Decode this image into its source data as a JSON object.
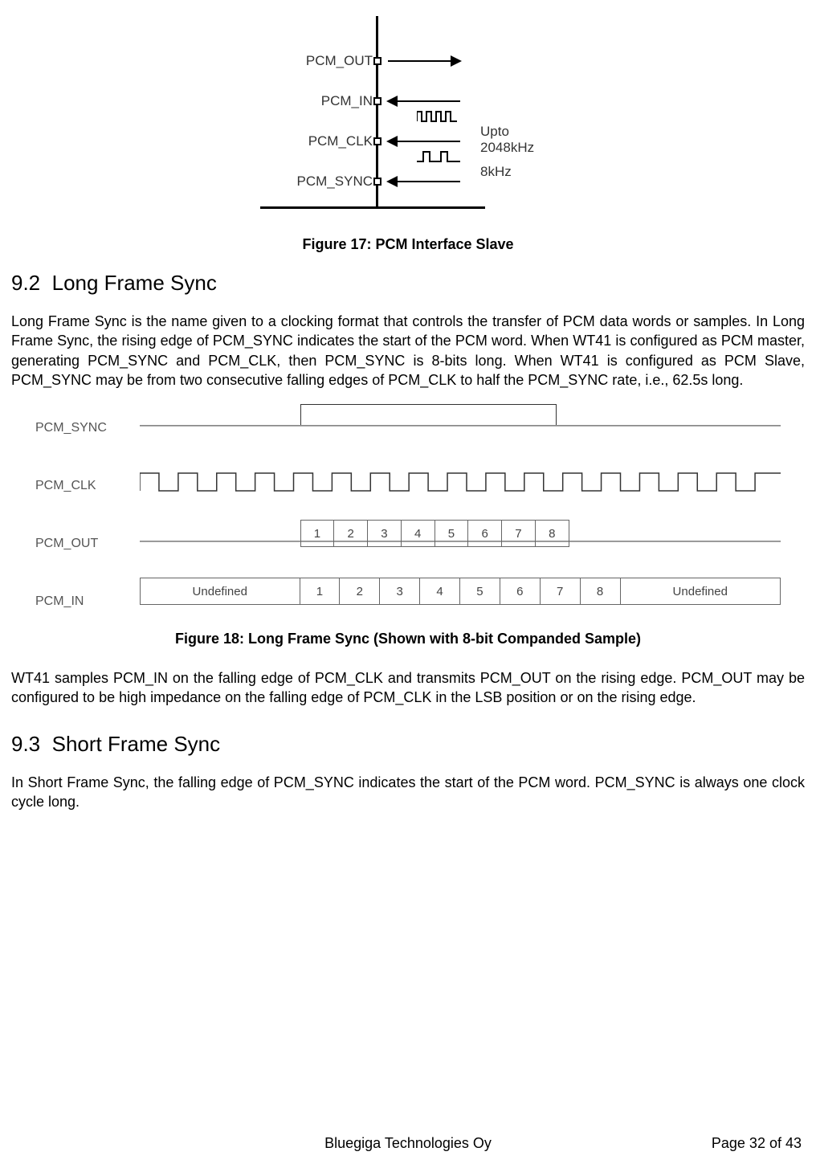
{
  "figure17": {
    "caption": "Figure 17: PCM Interface Slave",
    "signals": {
      "pcm_out": "PCM_OUT",
      "pcm_in": "PCM_IN",
      "pcm_clk": "PCM_CLK",
      "pcm_sync": "PCM_SYNC"
    },
    "notes": {
      "clk": "Upto 2048kHz",
      "sync": "8kHz"
    }
  },
  "section92": {
    "number": "9.2",
    "title": "Long Frame Sync",
    "para": "Long Frame Sync is the name given to a clocking format that controls the transfer of PCM data words or samples. In Long Frame Sync, the rising edge of PCM_SYNC indicates the start of the PCM word. When WT41 is configured as PCM master, generating PCM_SYNC and PCM_CLK, then PCM_SYNC is 8-bits long. When WT41 is configured as PCM Slave, PCM_SYNC may be from two consecutive falling edges of PCM_CLK to half the PCM_SYNC rate, i.e., 62.5s long."
  },
  "figure18": {
    "caption": "Figure 18: Long Frame Sync (Shown with 8-bit Companded Sample)",
    "labels": {
      "sync": "PCM_SYNC",
      "clk": "PCM_CLK",
      "out": "PCM_OUT",
      "in": "PCM_IN"
    },
    "bits": [
      "1",
      "2",
      "3",
      "4",
      "5",
      "6",
      "7",
      "8"
    ],
    "undefined_label": "Undefined"
  },
  "para_after18": "WT41 samples PCM_IN on the falling edge of PCM_CLK and transmits PCM_OUT on the rising edge. PCM_OUT may be configured to be high impedance on the falling edge of PCM_CLK in the LSB position or on the rising edge.",
  "section93": {
    "number": "9.3",
    "title": "Short Frame Sync",
    "para": "In Short Frame Sync, the falling edge of PCM_SYNC indicates the start of the PCM word. PCM_SYNC is always one clock cycle long."
  },
  "footer": {
    "company": "Bluegiga Technologies Oy",
    "page": "Page 32 of 43"
  },
  "chart_data": {
    "type": "table",
    "title": "PCM Long Frame Sync timing (8-bit companded sample)",
    "signals": [
      {
        "name": "PCM_SYNC",
        "description": "High for bits 1–8, low otherwise"
      },
      {
        "name": "PCM_CLK",
        "description": "Continuous clock, ~17 cycles shown"
      },
      {
        "name": "PCM_OUT",
        "bits": [
          1,
          2,
          3,
          4,
          5,
          6,
          7,
          8
        ],
        "before": "line",
        "after": "hi-z/line"
      },
      {
        "name": "PCM_IN",
        "bits": [
          1,
          2,
          3,
          4,
          5,
          6,
          7,
          8
        ],
        "before": "Undefined",
        "after": "Undefined"
      }
    ],
    "bit_count": 8
  }
}
